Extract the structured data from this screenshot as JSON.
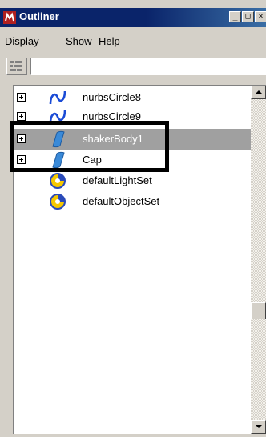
{
  "window": {
    "title": "Outliner",
    "app_icon": "maya-icon",
    "controls": {
      "minimize": "_",
      "maximize": "□",
      "close": "×"
    }
  },
  "menu": {
    "items": [
      "Display",
      "Show",
      "Help"
    ]
  },
  "toolbar": {
    "filter_icon": "filter-icon",
    "search_value": "",
    "search_placeholder": ""
  },
  "outliner": {
    "items": [
      {
        "label": "nurbsCircle8",
        "icon": "nurbs-curve-icon",
        "expandable": true,
        "selected": false
      },
      {
        "label": "nurbsCircle9",
        "icon": "nurbs-curve-icon",
        "expandable": true,
        "selected": false
      },
      {
        "label": "shakerBody1",
        "icon": "nurbs-surface-icon",
        "expandable": true,
        "selected": true
      },
      {
        "label": "Cap",
        "icon": "nurbs-surface-icon",
        "expandable": true,
        "selected": false
      },
      {
        "label": "defaultLightSet",
        "icon": "object-set-icon",
        "expandable": false,
        "selected": false
      },
      {
        "label": "defaultObjectSet",
        "icon": "object-set-icon",
        "expandable": false,
        "selected": false
      }
    ]
  },
  "colors": {
    "titlebar": "#0a246a",
    "selection": "#a0a0a0",
    "curve_icon": "#1a4bd6",
    "surface_icon": "#3a8ad8",
    "set_icon_yellow": "#f5c800"
  }
}
